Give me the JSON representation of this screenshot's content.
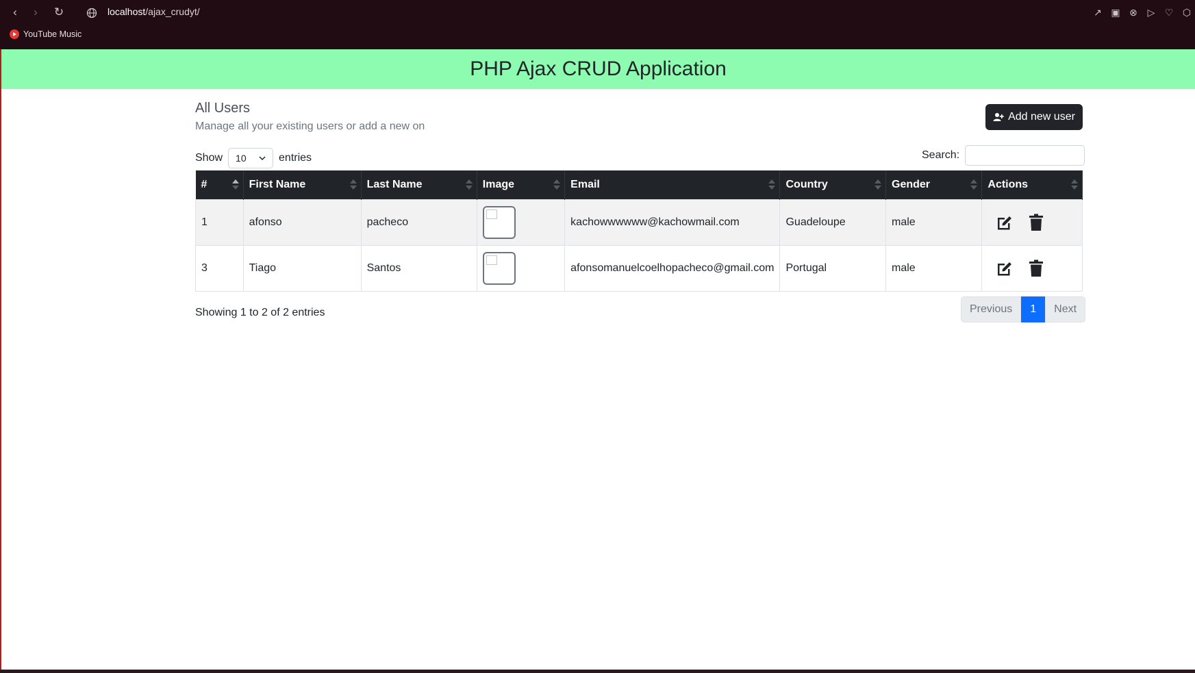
{
  "browser": {
    "url_host": "localhost",
    "url_path": "/ajax_crudyt/",
    "bookmark": "YouTube Music"
  },
  "app": {
    "title": "PHP Ajax CRUD Application"
  },
  "section": {
    "title": "All Users",
    "subtitle": "Manage all your existing users or add a new on",
    "add_button": "Add new user"
  },
  "table_controls": {
    "show_label": "Show",
    "entries_value": "10",
    "entries_label": "entries",
    "search_label": "Search:",
    "search_value": ""
  },
  "table": {
    "headers": [
      "#",
      "First Name",
      "Last Name",
      "Image",
      "Email",
      "Country",
      "Gender",
      "Actions"
    ],
    "rows": [
      {
        "id": "1",
        "first": "afonso",
        "last": "pacheco",
        "email": "kachowwwwww@kachowmail.com",
        "country": "Guadeloupe",
        "gender": "male"
      },
      {
        "id": "3",
        "first": "Tiago",
        "last": "Santos",
        "email": "afonsomanuelcoelhopacheco@gmail.com",
        "country": "Portugal",
        "gender": "male"
      }
    ]
  },
  "footer": {
    "info": "Showing 1 to 2 of 2 entries",
    "prev": "Previous",
    "page": "1",
    "next": "Next"
  },
  "colors": {
    "banner": "#8dfcb0",
    "dark": "#212529",
    "primary": "#0d6efd"
  },
  "icons": [
    "back-icon",
    "forward-icon",
    "reload-icon",
    "globe-icon",
    "edit-icon",
    "trash-icon",
    "user-plus-icon",
    "chevron-down-icon"
  ]
}
